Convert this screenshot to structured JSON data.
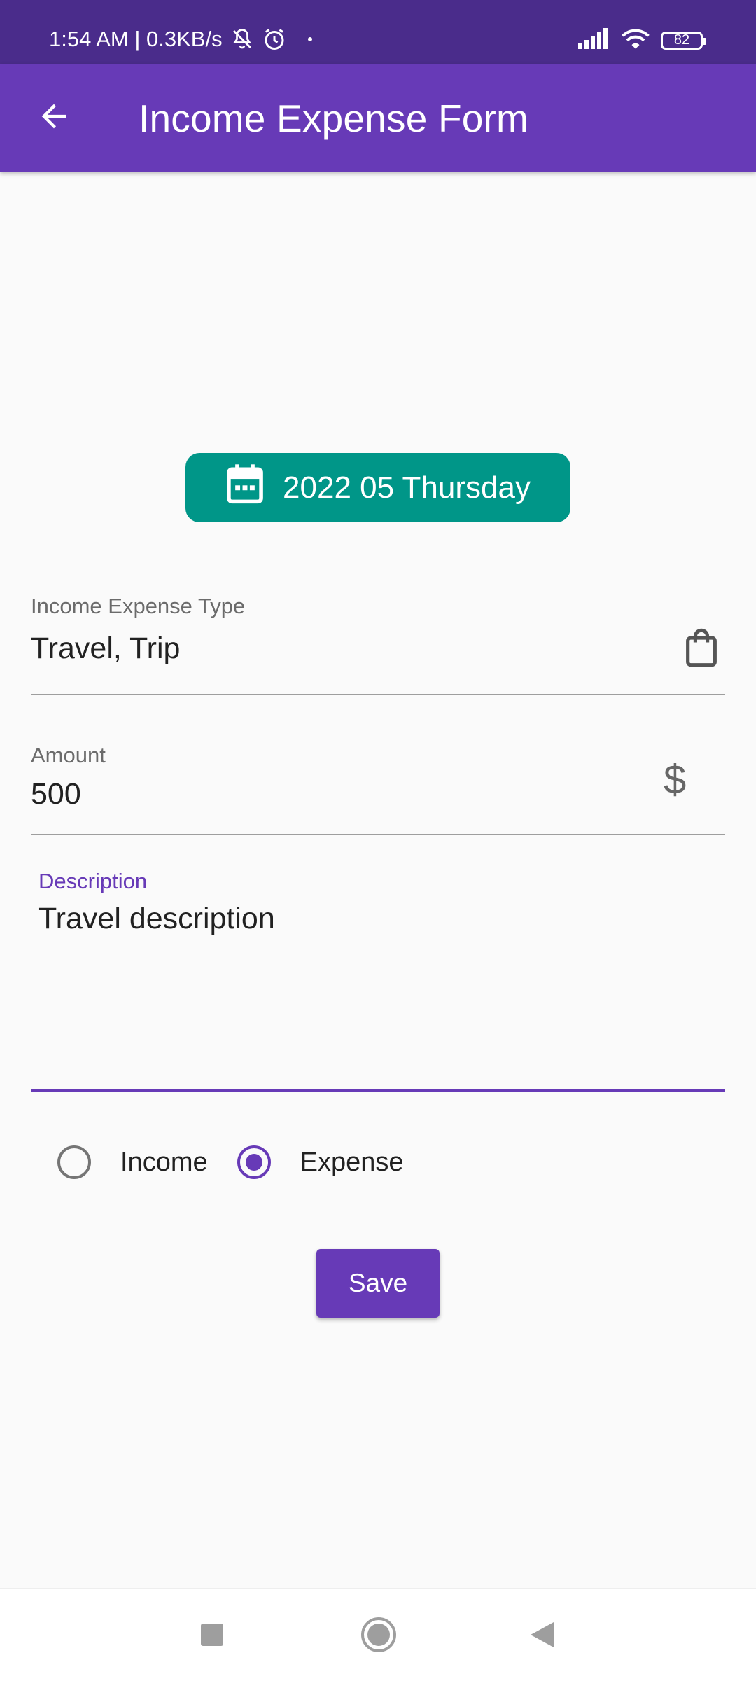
{
  "status_bar": {
    "time_network": "1:54 AM | 0.3KB/s",
    "battery_level": "82",
    "background_color": "#4A2C8B"
  },
  "app_bar": {
    "title": "Income Expense Form",
    "back_icon": "arrow-back-icon",
    "color": "#673AB7"
  },
  "date_button": {
    "label": "2022 05 Thursday",
    "icon": "calendar-icon",
    "color": "#009688"
  },
  "type_field": {
    "label": "Income Expense Type",
    "value": "Travel, Trip",
    "icon": "shopping-bag-icon"
  },
  "amount_field": {
    "label": "Amount",
    "value": "500",
    "icon": "dollar-icon"
  },
  "description_field": {
    "label": "Description",
    "value": "Travel description",
    "focused": true
  },
  "type_radio": {
    "options": [
      "Income",
      "Expense"
    ],
    "selected": "Expense"
  },
  "save_button": {
    "label": "Save"
  },
  "nav_bar": {
    "buttons": [
      "recent-apps-icon",
      "home-icon",
      "back-icon"
    ]
  }
}
